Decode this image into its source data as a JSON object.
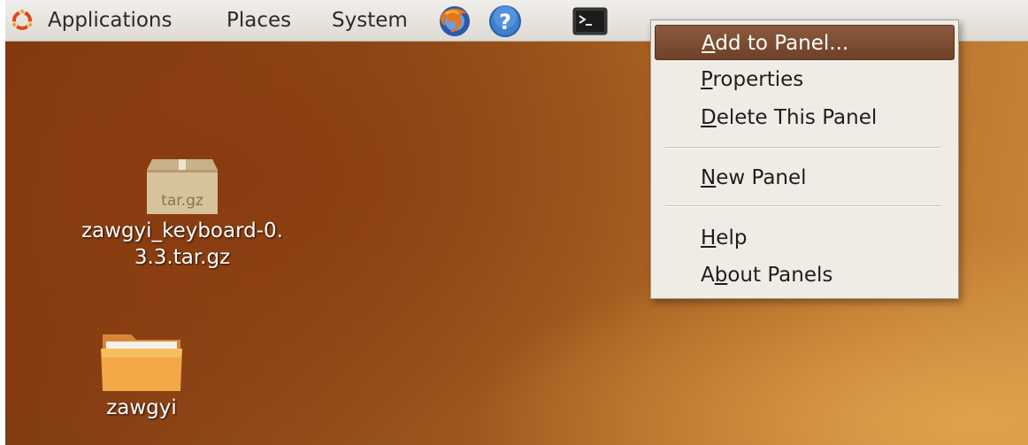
{
  "panel": {
    "menus": [
      "Applications",
      "Places",
      "System"
    ],
    "launchers": [
      "firefox-icon",
      "help-icon",
      "terminal-icon"
    ]
  },
  "desktop": {
    "icons": [
      {
        "type": "archive",
        "badge": "tar.gz",
        "label_line1": "zawgyi_keyboard-0.",
        "label_line2": "3.3.tar.gz"
      },
      {
        "type": "folder",
        "label_line1": "zawgyi"
      }
    ]
  },
  "context_menu": {
    "items": [
      {
        "mnemonic": "A",
        "rest": "dd to Panel...",
        "selected": true
      },
      {
        "mnemonic": "P",
        "rest": "roperties"
      },
      {
        "mnemonic": "D",
        "rest": "elete This Panel"
      },
      {
        "mnemonic": "N",
        "rest": "ew Panel"
      },
      {
        "mnemonic": "H",
        "rest": "elp"
      },
      {
        "prefix": "A",
        "mnemonic": "b",
        "rest": "out Panels"
      }
    ]
  },
  "colors": {
    "panel_bg": "#e8e5df",
    "menu_bg": "#efece6",
    "selection": "#7c4d33",
    "wallpaper": "#96501a"
  }
}
